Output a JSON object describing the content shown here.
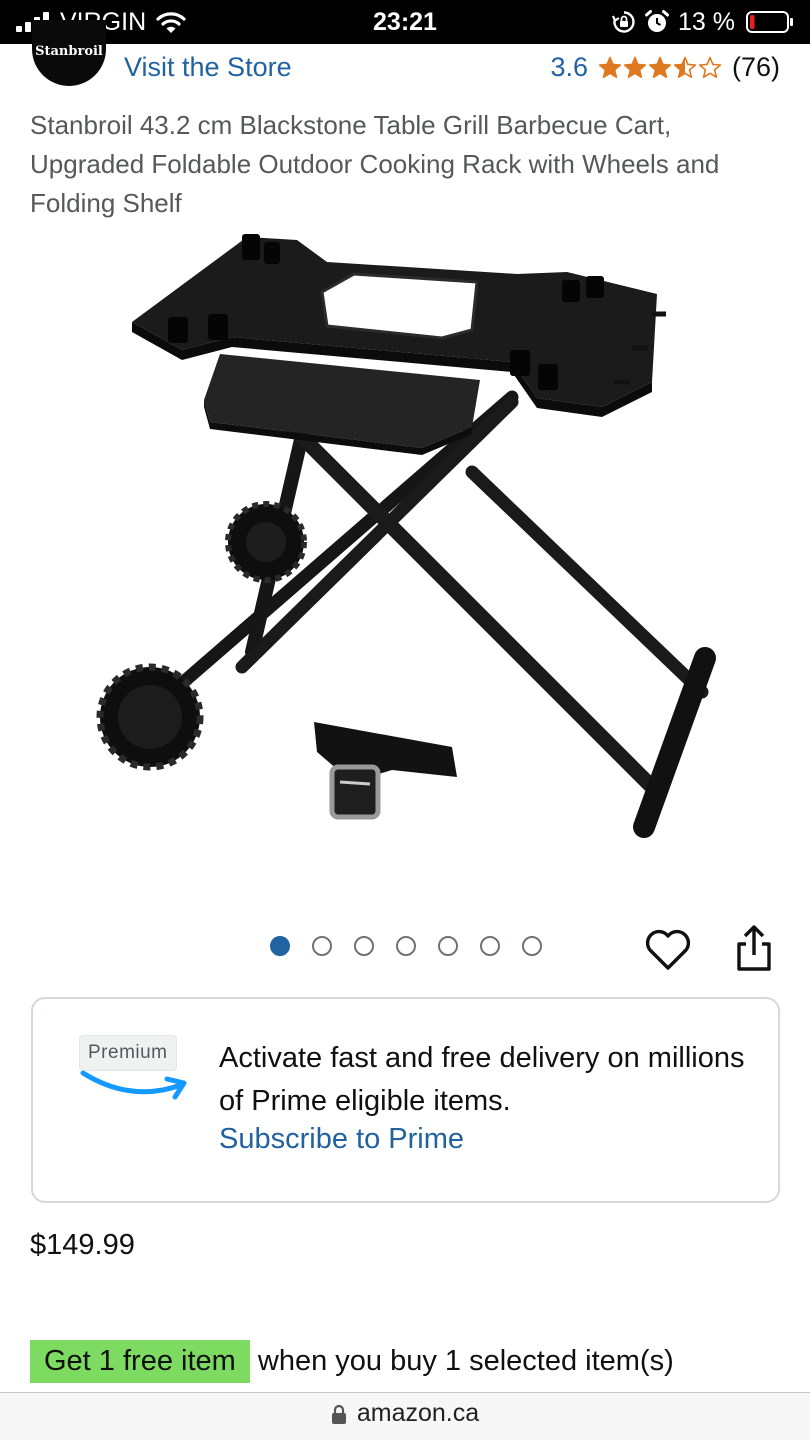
{
  "status_bar": {
    "carrier": "VIRGIN",
    "time": "23:21",
    "battery_pct": "13 %",
    "battery_level": 0.13,
    "battery_color": "#e62020"
  },
  "store": {
    "logo_text": "Stanbroil",
    "visit_label": "Visit the Store",
    "rating": "3.6",
    "rating_value": 3.6,
    "review_count": "(76)",
    "star_color": "#de7921"
  },
  "product": {
    "title": "Stanbroil 43.2 cm Blackstone Table Grill Barbecue Cart, Upgraded Foldable Outdoor Cooking Rack with Wheels and Folding Shelf",
    "image_count": 7,
    "active_image": 1
  },
  "icons": {
    "wishlist": "heart-icon",
    "share": "share-icon",
    "lock": "lock-icon"
  },
  "prime": {
    "badge": "Premium",
    "text": "Activate fast and free delivery on millions of Prime eligible items.",
    "link": "Subscribe to Prime",
    "swoosh_color": "#1399ff"
  },
  "price": "$149.99",
  "promo": {
    "badge": "Get 1 free item",
    "text": " when you buy 1 selected item(s)",
    "badge_color": "#7ddb61"
  },
  "browser": {
    "url": "amazon.ca"
  },
  "colors": {
    "link": "#2162a1",
    "text": "#0f1111",
    "muted": "#565959"
  }
}
